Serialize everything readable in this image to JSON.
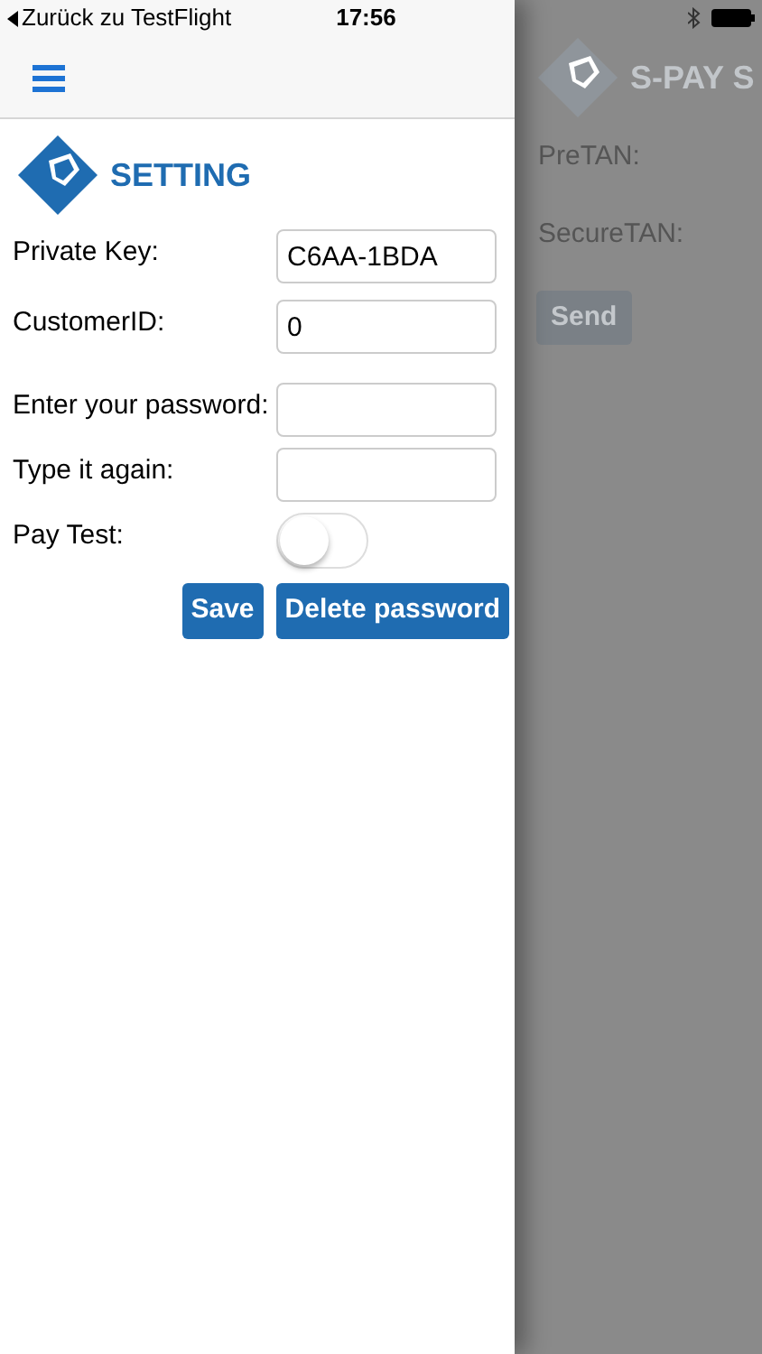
{
  "status_bar": {
    "back_link": "Zurück zu TestFlight",
    "time": "17:56"
  },
  "drawer": {
    "title": "SETTING",
    "fields": [
      {
        "kind": "input",
        "label": "Private Key:",
        "value": "C6AA-1BDA"
      },
      {
        "kind": "input",
        "label": "CustomerID:",
        "value": "0"
      },
      {
        "kind": "input",
        "label": "Enter your password:"
      },
      {
        "kind": "input",
        "label": "Type it again:"
      },
      {
        "kind": "toggle",
        "label": "Pay Test:",
        "on": false
      }
    ],
    "buttons": [
      "Save",
      "Delete password"
    ]
  },
  "background_page": {
    "title": "S-PAY S",
    "labels": [
      "PreTAN:",
      "SecureTAN:"
    ],
    "button": "Send"
  }
}
